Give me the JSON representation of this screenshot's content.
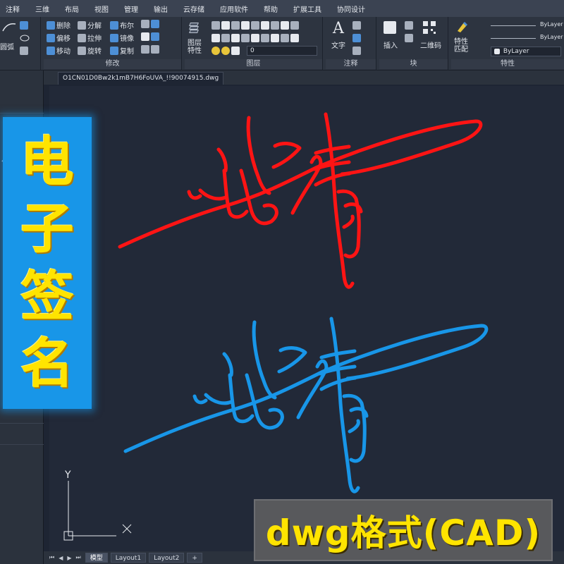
{
  "menu": [
    "注释",
    "三维",
    "布局",
    "视图",
    "管理",
    "输出",
    "云存储",
    "应用软件",
    "帮助",
    "扩展工具",
    "协同设计"
  ],
  "ribbon": {
    "draw_partial": "圆弧",
    "modify": {
      "tools": [
        "删除",
        "分解",
        "布尔",
        "偏移",
        "拉伸",
        "镜像",
        "移动",
        "旋转",
        "复制"
      ],
      "title": "修改"
    },
    "layers": {
      "properties_label": "图层\n特性",
      "layer_value": "0",
      "title": "图层"
    },
    "annotation": {
      "text_label": "文字",
      "title": "注释"
    },
    "block": {
      "insert_label": "插入",
      "qrcode_label": "二维码",
      "title": "块"
    },
    "properties": {
      "match_label": "特性\n匹配",
      "bylayer_1": "ByLayer",
      "bylayer_2": "ByLayer",
      "bylayer_3": "ByLayer",
      "title": "特性"
    }
  },
  "document_tab": "O1CN01D0Bw2k1mB7H6FoUVA_!!90074915.dwg",
  "layout_tabs": [
    "模型",
    "Layout1",
    "Layout2",
    "+"
  ],
  "ucs": {
    "y_label": "Y",
    "x_label": "X"
  },
  "banner": {
    "chars": [
      "电",
      "子",
      "签",
      "名"
    ]
  },
  "format_badge": "dwg格式(CAD)",
  "colors": {
    "signature_red": "#ff1414",
    "signature_blue": "#1896e8",
    "banner_yellow": "#ffe400",
    "canvas": "#222938"
  }
}
